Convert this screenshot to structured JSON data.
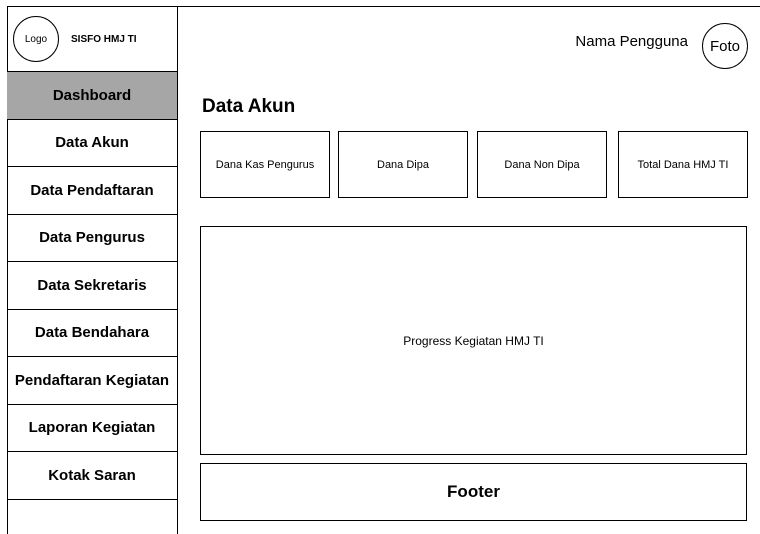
{
  "header": {
    "logo_text": "Logo",
    "app_title": "SISFO HMJ TI",
    "user_name": "Nama Pengguna",
    "photo_text": "Foto"
  },
  "sidebar": {
    "items": [
      {
        "label": "Dashboard"
      },
      {
        "label": "Data Akun"
      },
      {
        "label": "Data Pendaftaran"
      },
      {
        "label": "Data Pengurus"
      },
      {
        "label": "Data Sekretaris"
      },
      {
        "label": "Data Bendahara"
      },
      {
        "label": "Pendaftaran Kegiatan"
      },
      {
        "label": "Laporan Kegiatan"
      },
      {
        "label": "Kotak Saran"
      }
    ],
    "active_color": "#a6a6a6"
  },
  "main": {
    "title": "Data Akun",
    "cards": [
      {
        "label": "Dana Kas Pengurus"
      },
      {
        "label": "Dana Dipa"
      },
      {
        "label": "Dana Non Dipa"
      },
      {
        "label": "Total Dana HMJ TI"
      }
    ],
    "progress_label": "Progress Kegiatan HMJ TI"
  },
  "footer": {
    "label": "Footer"
  }
}
